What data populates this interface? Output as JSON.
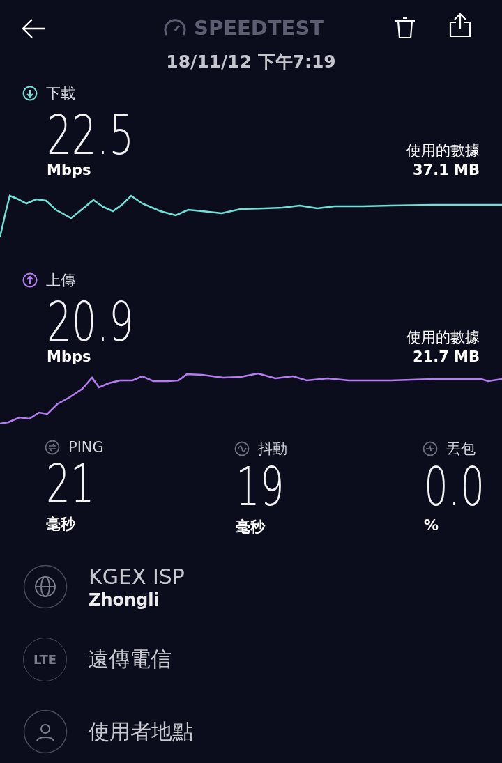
{
  "header": {
    "title": "SPEEDTEST",
    "date": "18/11/12 下午7:19"
  },
  "speeds": [
    {
      "kind": "download",
      "label": "下載",
      "value": "22.5",
      "unit": "Mbps",
      "data_label": "使用的數據",
      "data_value": "37.1 MB"
    },
    {
      "kind": "upload",
      "label": "上傳",
      "value": "20.9",
      "unit": "Mbps",
      "data_label": "使用的數據",
      "data_value": "21.7 MB"
    }
  ],
  "metrics": [
    {
      "kind": "ping",
      "label": "PING",
      "value": "21",
      "unit": "毫秒"
    },
    {
      "kind": "jitter",
      "label": "抖動",
      "value": "19",
      "unit": "毫秒"
    },
    {
      "kind": "loss",
      "label": "丟包",
      "value": "0.0",
      "unit": "%"
    }
  ],
  "details": [
    {
      "kind": "isp",
      "title": "KGEX ISP",
      "subtitle": "Zhongli"
    },
    {
      "kind": "carrier",
      "badge": "LTE",
      "title": "遠傳電信"
    },
    {
      "kind": "location",
      "title": "使用者地點"
    }
  ]
}
